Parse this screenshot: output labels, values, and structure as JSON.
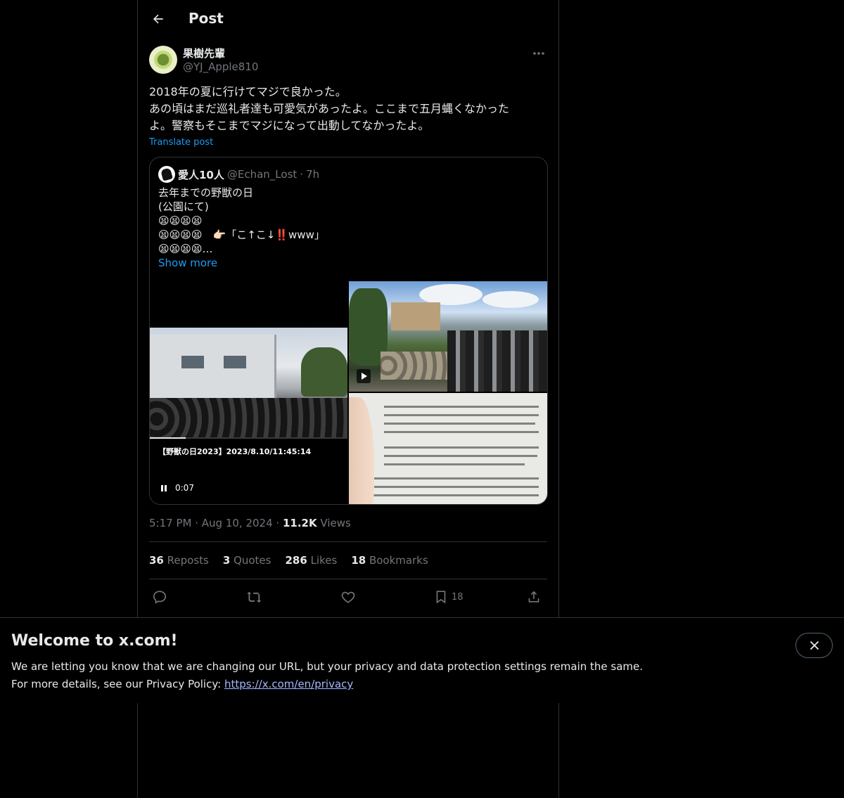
{
  "header": {
    "title": "Post"
  },
  "post": {
    "author_name": "果樹先輩",
    "author_handle": "@YJ_Apple810",
    "text": "2018年の夏に行けてマジで良かった。\nあの頃はまだ巡礼者達も可愛気があったよ。ここまで五月蝿くなかった\nよ。警察もそこまでマジになって出動してなかったよ。",
    "translate_label": "Translate post",
    "time": "5:17 PM",
    "date": "Aug 10, 2024",
    "views_count": "11.2K",
    "views_label": "Views"
  },
  "quote": {
    "name": "愛人10人",
    "handle": "@Echan_Lost",
    "separator": "·",
    "time": "7h",
    "text": "去年までの野獣の日\n(公園にて)\n😫😫😫😫\n😫😫😫😫　👉🏻「こ↑こ↓‼️www」\n😫😫😫😫…",
    "show_more": "Show more",
    "video": {
      "caption": "【野獣の日2023】2023/8.10/11:45:14",
      "timestamp": "0:07",
      "progress": 0.18
    }
  },
  "stats": {
    "reposts_count": "36",
    "reposts_label": "Reposts",
    "quotes_count": "3",
    "quotes_label": "Quotes",
    "likes_count": "286",
    "likes_label": "Likes",
    "bookmarks_count": "18",
    "bookmarks_label": "Bookmarks"
  },
  "actions": {
    "bookmark_count": "18",
    "icons": [
      "reply-icon",
      "repost-icon",
      "like-icon",
      "bookmark-icon",
      "share-icon"
    ]
  },
  "banner": {
    "title": "Welcome to x.com!",
    "line1": "We are letting you know that we are changing our URL, but your privacy and data protection settings remain the same.",
    "line2_prefix": "For more details, see our Privacy Policy: ",
    "link": "https://x.com/en/privacy"
  },
  "colors": {
    "background": "#000000",
    "text": "#e7e9ea",
    "secondary": "#71767b",
    "accent": "#1d9bf0",
    "border": "#2f3336",
    "link": "#a7b6ff"
  }
}
